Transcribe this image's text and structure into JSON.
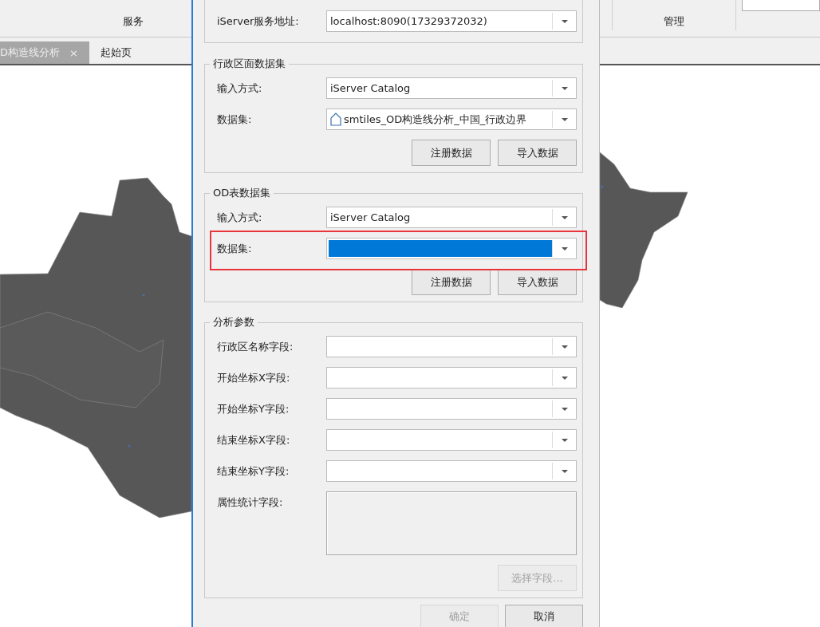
{
  "ribbon": {
    "groups": [
      {
        "label": "服务"
      },
      {
        "label": "管理"
      }
    ]
  },
  "tabs": [
    {
      "label": "D构造线分析",
      "close": "×",
      "selected": true
    },
    {
      "label": "起始页",
      "selected": false
    }
  ],
  "dialog": {
    "sections": [
      {
        "rows": [
          {
            "label": "iServer服务地址:",
            "kind": "combo",
            "value": "localhost:8090(17329372032)",
            "show_icon": false,
            "highlighted": false
          }
        ]
      },
      {
        "title": "行政区面数据集",
        "rows": [
          {
            "label": "输入方式:",
            "kind": "combo",
            "value": "iServer Catalog",
            "show_icon": false,
            "highlighted": false
          },
          {
            "label": "数据集:",
            "kind": "combo",
            "value": "smtiles_OD构造线分析_中国_行政边界",
            "show_icon": true,
            "highlighted": false
          }
        ],
        "buttons": [
          {
            "label": "注册数据",
            "disabled": false
          },
          {
            "label": "导入数据",
            "disabled": false
          }
        ]
      },
      {
        "title": "OD表数据集",
        "rows": [
          {
            "label": "输入方式:",
            "kind": "combo",
            "value": "iServer Catalog",
            "show_icon": false,
            "highlighted": false
          },
          {
            "label": "数据集:",
            "kind": "combo",
            "focused": true,
            "show_icon": false,
            "highlighted": true
          }
        ],
        "buttons": [
          {
            "label": "注册数据",
            "disabled": false
          },
          {
            "label": "导入数据",
            "disabled": false
          }
        ]
      },
      {
        "title": "分析参数",
        "rows": [
          {
            "label": "行政区名称字段:",
            "kind": "combo",
            "show_icon": false,
            "highlighted": false
          },
          {
            "label": "开始坐标X字段:",
            "kind": "combo",
            "show_icon": false,
            "highlighted": false
          },
          {
            "label": "开始坐标Y字段:",
            "kind": "combo",
            "show_icon": false,
            "highlighted": false
          },
          {
            "label": "结束坐标X字段:",
            "kind": "combo",
            "show_icon": false,
            "highlighted": false
          },
          {
            "label": "结束坐标Y字段:",
            "kind": "combo",
            "show_icon": false,
            "highlighted": false
          },
          {
            "label": "属性统计字段:",
            "kind": "list",
            "show_icon": false,
            "highlighted": false
          }
        ],
        "buttons": [
          {
            "label": "选择字段...",
            "disabled": true
          }
        ]
      }
    ],
    "footer": [
      {
        "label": "确定",
        "disabled": true
      },
      {
        "label": "取消",
        "disabled": false
      }
    ]
  }
}
